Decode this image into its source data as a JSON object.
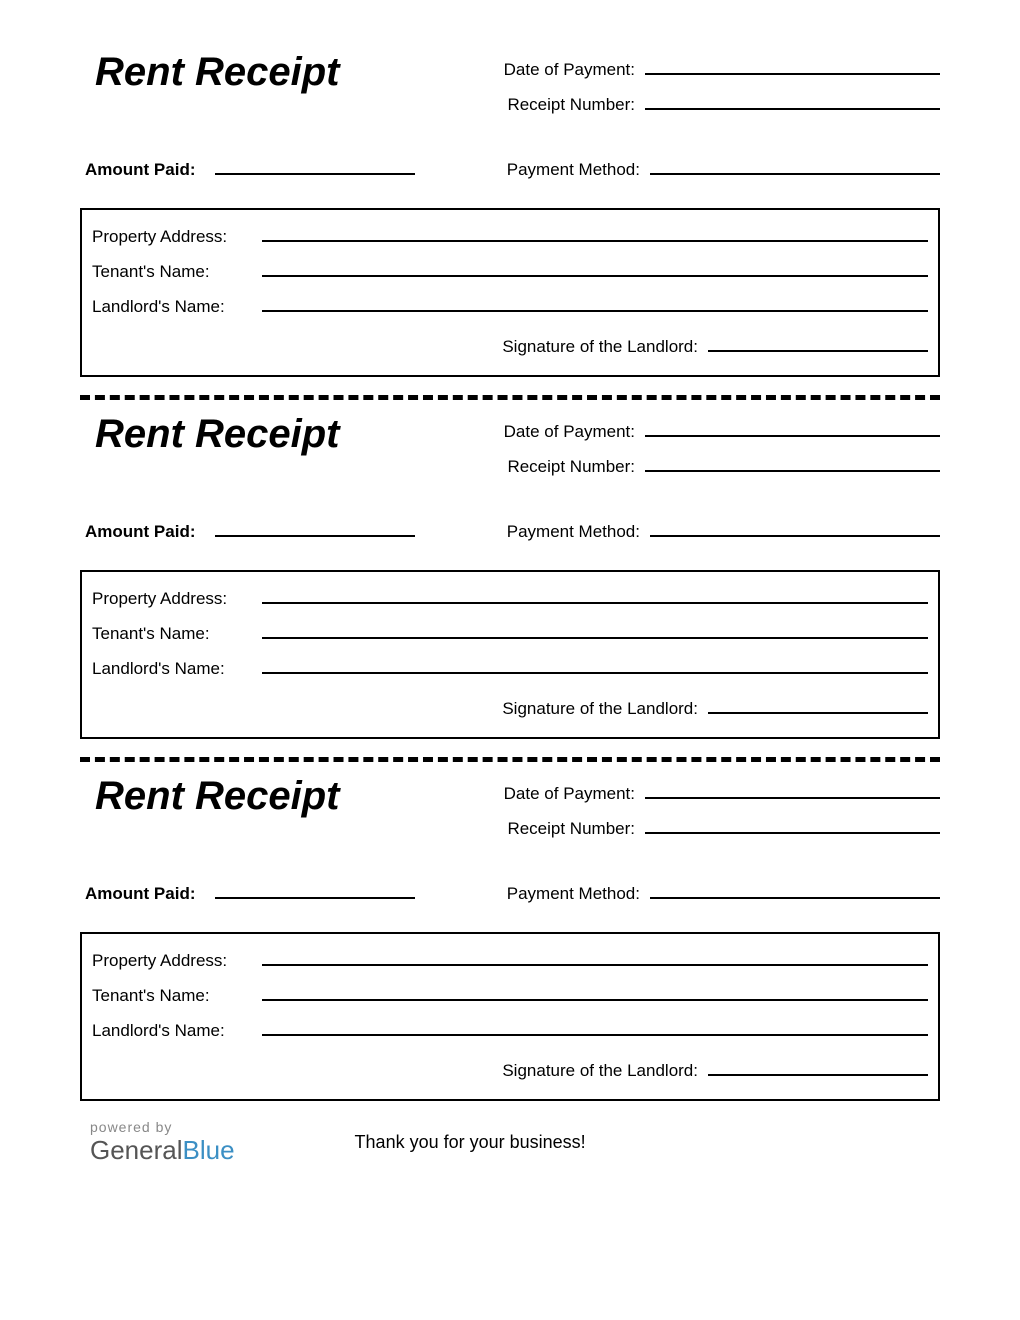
{
  "receipt": {
    "title": "Rent Receipt",
    "date_label": "Date of Payment:",
    "number_label": "Receipt Number:",
    "amount_label": "Amount Paid:",
    "payment_method_label": "Payment Method:",
    "property_address_label": "Property Address:",
    "tenant_name_label": "Tenant's Name:",
    "landlord_name_label": "Landlord's Name:",
    "signature_label": "Signature of the Landlord:"
  },
  "footer": {
    "powered_by": "powered by",
    "brand_general": "General",
    "brand_blue": "Blue",
    "thank_you": "Thank you for your business!"
  }
}
